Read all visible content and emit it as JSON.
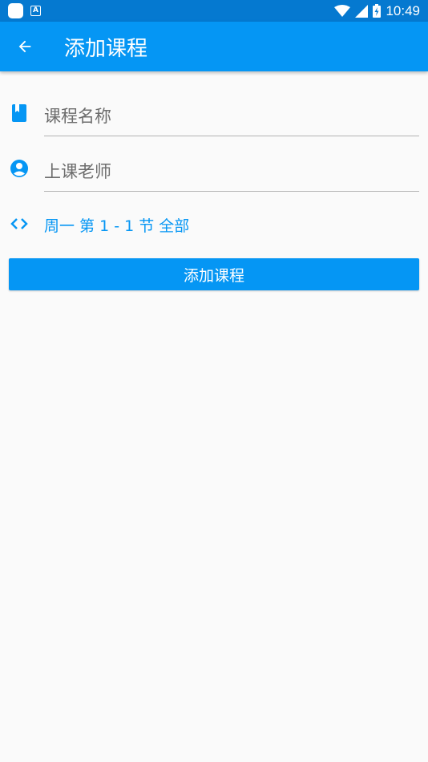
{
  "status_bar": {
    "time": "10:49",
    "icons": [
      "app-icon",
      "a-icon",
      "wifi-icon",
      "signal-icon",
      "battery-charging-icon"
    ]
  },
  "app_bar": {
    "title": "添加课程",
    "back_icon": "arrow-left-icon"
  },
  "form": {
    "course_name": {
      "icon": "book-icon",
      "placeholder": "课程名称",
      "value": ""
    },
    "teacher": {
      "icon": "account-circle-icon",
      "placeholder": "上课老师",
      "value": ""
    },
    "schedule": {
      "icon": "code-brackets-icon",
      "text": "周一 第 1 - 1 节  全部"
    }
  },
  "submit_label": "添加课程",
  "colors": {
    "status_bar": "#0579d0",
    "primary": "#0596f4",
    "background": "#fafafa",
    "divider": "#b3b3b3"
  }
}
